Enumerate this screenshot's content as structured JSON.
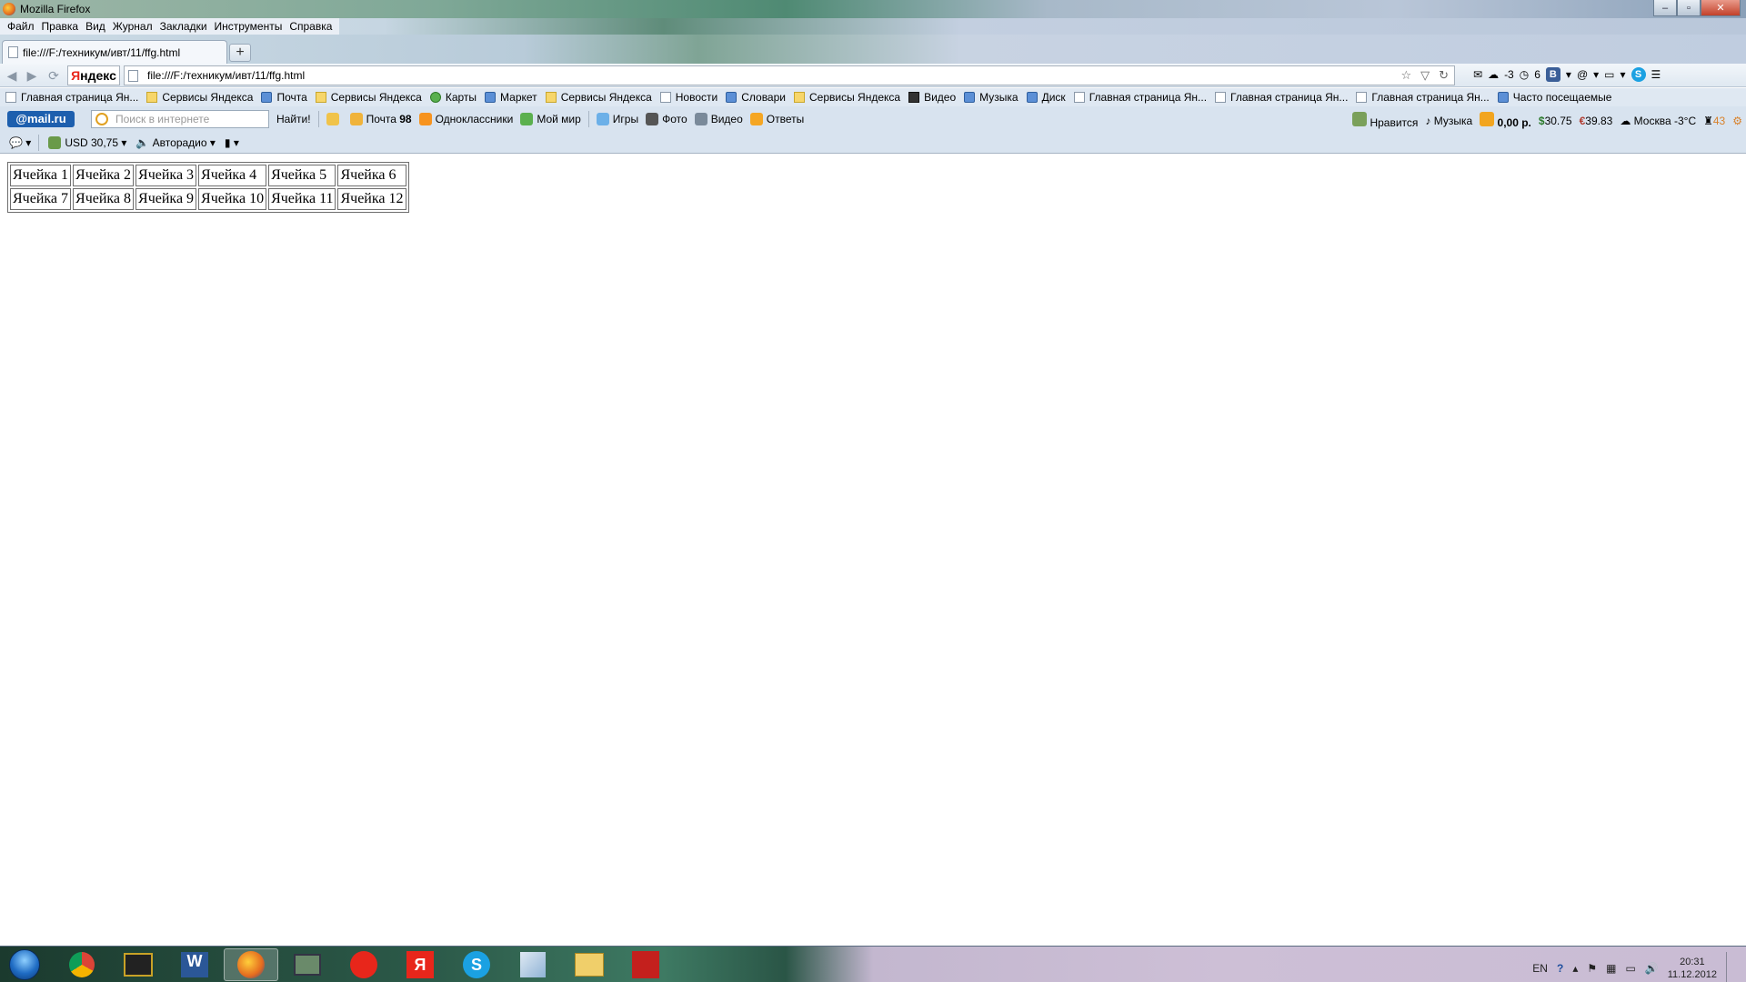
{
  "window": {
    "title": "Mozilla Firefox"
  },
  "menu": [
    "Файл",
    "Правка",
    "Вид",
    "Журнал",
    "Закладки",
    "Инструменты",
    "Справка"
  ],
  "tab": {
    "title": "file:///F:/техникум/ивт/11/ffg.html",
    "new_tab_label": "+"
  },
  "navbar": {
    "yandex_label_first": "Я",
    "yandex_label_rest": "ндекс",
    "url": "file:///F:/техникум/ивт/11/ffg.html",
    "weather_value": "-3",
    "counter_value": "6",
    "vk_label": "В",
    "at_label": "@",
    "skype_label": "S"
  },
  "bookmarks": [
    {
      "label": "Главная страница Ян...",
      "icon": "page-icon"
    },
    {
      "label": "Сервисы Яндекса",
      "icon": "folder-icon"
    },
    {
      "label": "Почта",
      "icon": "mail-icon"
    },
    {
      "label": "Сервисы Яндекса",
      "icon": "folder-icon"
    },
    {
      "label": "Карты",
      "icon": "maps-icon"
    },
    {
      "label": "Маркет",
      "icon": "market-icon"
    },
    {
      "label": "Сервисы Яндекса",
      "icon": "folder-icon"
    },
    {
      "label": "Новости",
      "icon": "news-icon"
    },
    {
      "label": "Словари",
      "icon": "dictionary-icon"
    },
    {
      "label": "Сервисы Яндекса",
      "icon": "folder-icon"
    },
    {
      "label": "Видео",
      "icon": "video-icon"
    },
    {
      "label": "Музыка",
      "icon": "music-icon"
    },
    {
      "label": "Диск",
      "icon": "disk-icon"
    },
    {
      "label": "Главная страница Ян...",
      "icon": "page-icon"
    },
    {
      "label": "Главная страница Ян...",
      "icon": "page-icon"
    },
    {
      "label": "Главная страница Ян...",
      "icon": "page-icon"
    },
    {
      "label": "Часто посещаемые",
      "icon": "frequent-icon"
    }
  ],
  "mailbar": {
    "logo": "@mail.ru",
    "search_placeholder": "Поиск в интернете",
    "find_label": "Найти!",
    "mail_label": "Почта",
    "mail_count": "98",
    "ok_label": "Одноклассники",
    "myworld_label": "Мой мир",
    "games_label": "Игры",
    "photo_label": "Фото",
    "video_label": "Видео",
    "answers_label": "Ответы",
    "like_label": "Нравится",
    "music_label": "Музыка",
    "balance": "0,00 р.",
    "usd_rate": "30.75",
    "eur_rate": "39.83",
    "weather": "Москва -3°С",
    "notifications": "43",
    "usd_symbol": "$",
    "eur_symbol": "€"
  },
  "row3": {
    "currency": "USD 30,75",
    "radio": "Авторадио"
  },
  "table": {
    "rows": [
      [
        "Ячейка 1",
        "Ячейка 2",
        "Ячейка 3",
        "Ячейка 4",
        "Ячейка 5",
        "Ячейка 6"
      ],
      [
        "Ячейка 7",
        "Ячейка 8",
        "Ячейка 9",
        "Ячейка 10",
        "Ячейка 11",
        "Ячейка 12"
      ]
    ]
  },
  "taskbar": {
    "items": [
      "Chrome",
      "Terminal",
      "W",
      "Firefox",
      "Computer",
      "Yandex",
      "Я",
      "S",
      "Notes",
      "Explorer",
      "PDF"
    ],
    "word_label": "W",
    "yandex_label": "Я",
    "skype_label": "S",
    "lang": "EN",
    "time": "20:31",
    "date": "11.12.2012"
  },
  "colors": {
    "accent": "#1d5fae",
    "yandex_red": "#e8261b"
  }
}
